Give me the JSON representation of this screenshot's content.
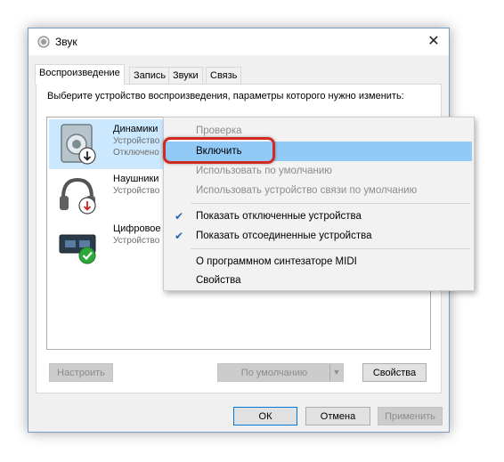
{
  "window": {
    "title": "Звук"
  },
  "tabs": [
    {
      "label": "Воспроизведение"
    },
    {
      "label": "Запись"
    },
    {
      "label": "Звуки"
    },
    {
      "label": "Связь"
    }
  ],
  "instruction": "Выберите устройство воспроизведения, параметры которого нужно изменить:",
  "devices": [
    {
      "name": "Динамики",
      "line1": "Устройство",
      "line2": "Отключено",
      "status_icon": "down-arrow-icon"
    },
    {
      "name": "Наушники",
      "line1": "Устройство",
      "line2": "",
      "status_icon": "down-arrow-red-icon"
    },
    {
      "name": "Цифровое а",
      "line1": "Устройство",
      "line2": "",
      "status_icon": "green-check-icon"
    }
  ],
  "bottom_buttons": {
    "configure": "Настроить",
    "default": "По умолчанию",
    "properties": "Свойства"
  },
  "dialog_buttons": {
    "ok": "ОК",
    "cancel": "Отмена",
    "apply": "Применить"
  },
  "context_menu": {
    "items": [
      {
        "label": "Проверка"
      },
      {
        "label": "Включить"
      },
      {
        "label": "Использовать по умолчанию"
      },
      {
        "label": "Использовать устройство связи по умолчанию"
      },
      {
        "label": "Показать отключенные устройства"
      },
      {
        "label": "Показать отсоединенные устройства"
      },
      {
        "label": "О программном синтезаторе MIDI"
      },
      {
        "label": "Свойства"
      }
    ]
  },
  "colors": {
    "accent": "#0078d7",
    "selection": "#cce8ff",
    "menu_highlight": "#91c9f7",
    "ring": "#d32b22"
  }
}
